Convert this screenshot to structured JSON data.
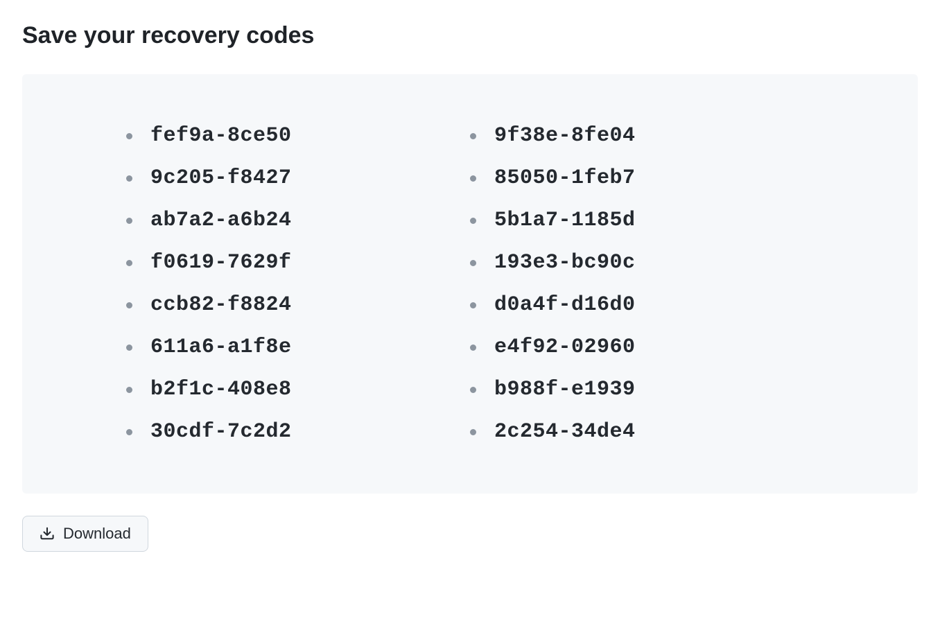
{
  "heading": "Save your recovery codes",
  "recovery_codes": {
    "left": [
      "fef9a-8ce50",
      "9c205-f8427",
      "ab7a2-a6b24",
      "f0619-7629f",
      "ccb82-f8824",
      "611a6-a1f8e",
      "b2f1c-408e8",
      "30cdf-7c2d2"
    ],
    "right": [
      "9f38e-8fe04",
      "85050-1feb7",
      "5b1a7-1185d",
      "193e3-bc90c",
      "d0a4f-d16d0",
      "e4f92-02960",
      "b988f-e1939",
      "2c254-34de4"
    ]
  },
  "buttons": {
    "download_label": "Download"
  }
}
